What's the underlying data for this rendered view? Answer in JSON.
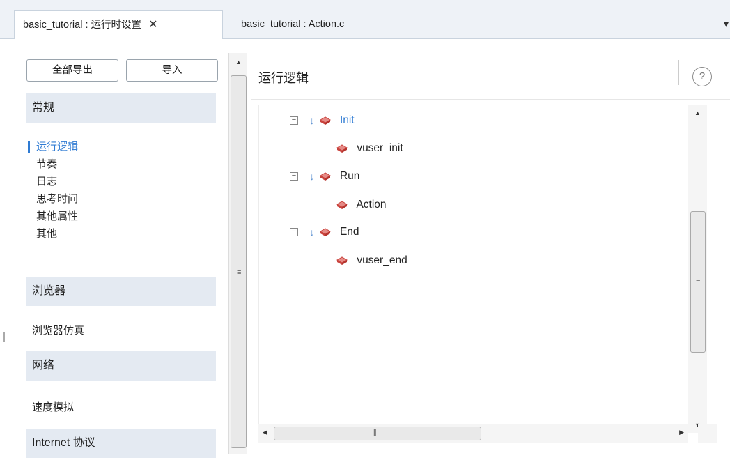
{
  "tabs": [
    {
      "label": "basic_tutorial : 运行时设置",
      "close": "✕"
    },
    {
      "label": "basic_tutorial : Action.c"
    }
  ],
  "tab_menu_icon": "▾",
  "toolbar": {
    "export_label": "全部导出",
    "import_label": "导入"
  },
  "nav": {
    "section_general": "常规",
    "general_items": [
      "运行逻辑",
      "节奏",
      "日志",
      "思考时间",
      "其他属性",
      "其他"
    ],
    "section_browser": "浏览器",
    "browser_items": [
      "浏览器仿真"
    ],
    "section_network": "网络",
    "network_items": [
      "速度模拟"
    ],
    "section_internet": "Internet 协议"
  },
  "panel": {
    "title": "运行逻辑",
    "help": "?"
  },
  "tree": [
    {
      "group": "Init",
      "child": "vuser_init",
      "active": true
    },
    {
      "group": "Run",
      "child": "Action",
      "active": false
    },
    {
      "group": "End",
      "child": "vuser_end",
      "active": false
    }
  ],
  "colors": {
    "accent": "#2f7bd3",
    "section_bg": "#e4eaf2",
    "brick": "#d9534f"
  }
}
